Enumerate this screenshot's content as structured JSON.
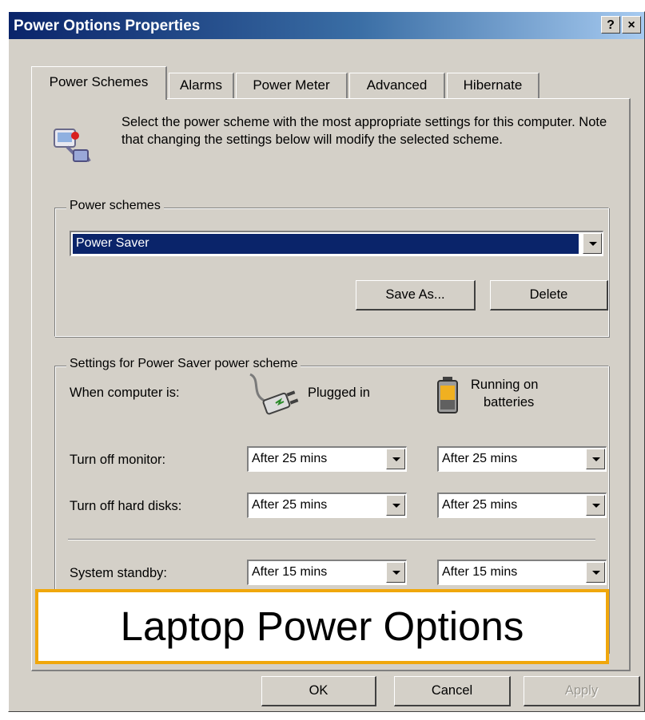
{
  "window": {
    "title": "Power Options Properties",
    "help_btn": "?",
    "close_btn": "×"
  },
  "tabs": [
    {
      "label": "Power Schemes",
      "active": true
    },
    {
      "label": "Alarms"
    },
    {
      "label": "Power Meter"
    },
    {
      "label": "Advanced"
    },
    {
      "label": "Hibernate"
    }
  ],
  "intro": {
    "icon": "power-scheme-icon",
    "text": "Select the power scheme with the most appropriate settings for this computer. Note that changing the settings below will modify the selected scheme."
  },
  "power_schemes": {
    "group_label": "Power schemes",
    "selected": "Power Saver",
    "save_as": "Save As...",
    "delete": "Delete"
  },
  "settings": {
    "group_label": "Settings for Power Saver power scheme",
    "when_label": "When computer is:",
    "plugged_in": "Plugged in",
    "plugged_icon": "power-plug-icon",
    "running_on": "Running on",
    "batteries": "batteries",
    "battery_icon": "battery-icon",
    "rows": [
      {
        "label": "Turn off monitor:",
        "plugged": "After 25 mins",
        "battery": "After 25 mins"
      },
      {
        "label": "Turn off hard disks:",
        "plugged": "After 25 mins",
        "battery": "After 25 mins"
      },
      {
        "label": "System standby:",
        "plugged": "After 15 mins",
        "battery": "After 15 mins"
      }
    ]
  },
  "overlay_caption": "Laptop Power Options",
  "buttons": {
    "ok": "OK",
    "cancel": "Cancel",
    "apply": "Apply"
  },
  "colors": {
    "title_gradient_start": "#0a246a",
    "face": "#d4d0c8",
    "selection": "#0a246a",
    "caption_border": "#f0a70c"
  }
}
